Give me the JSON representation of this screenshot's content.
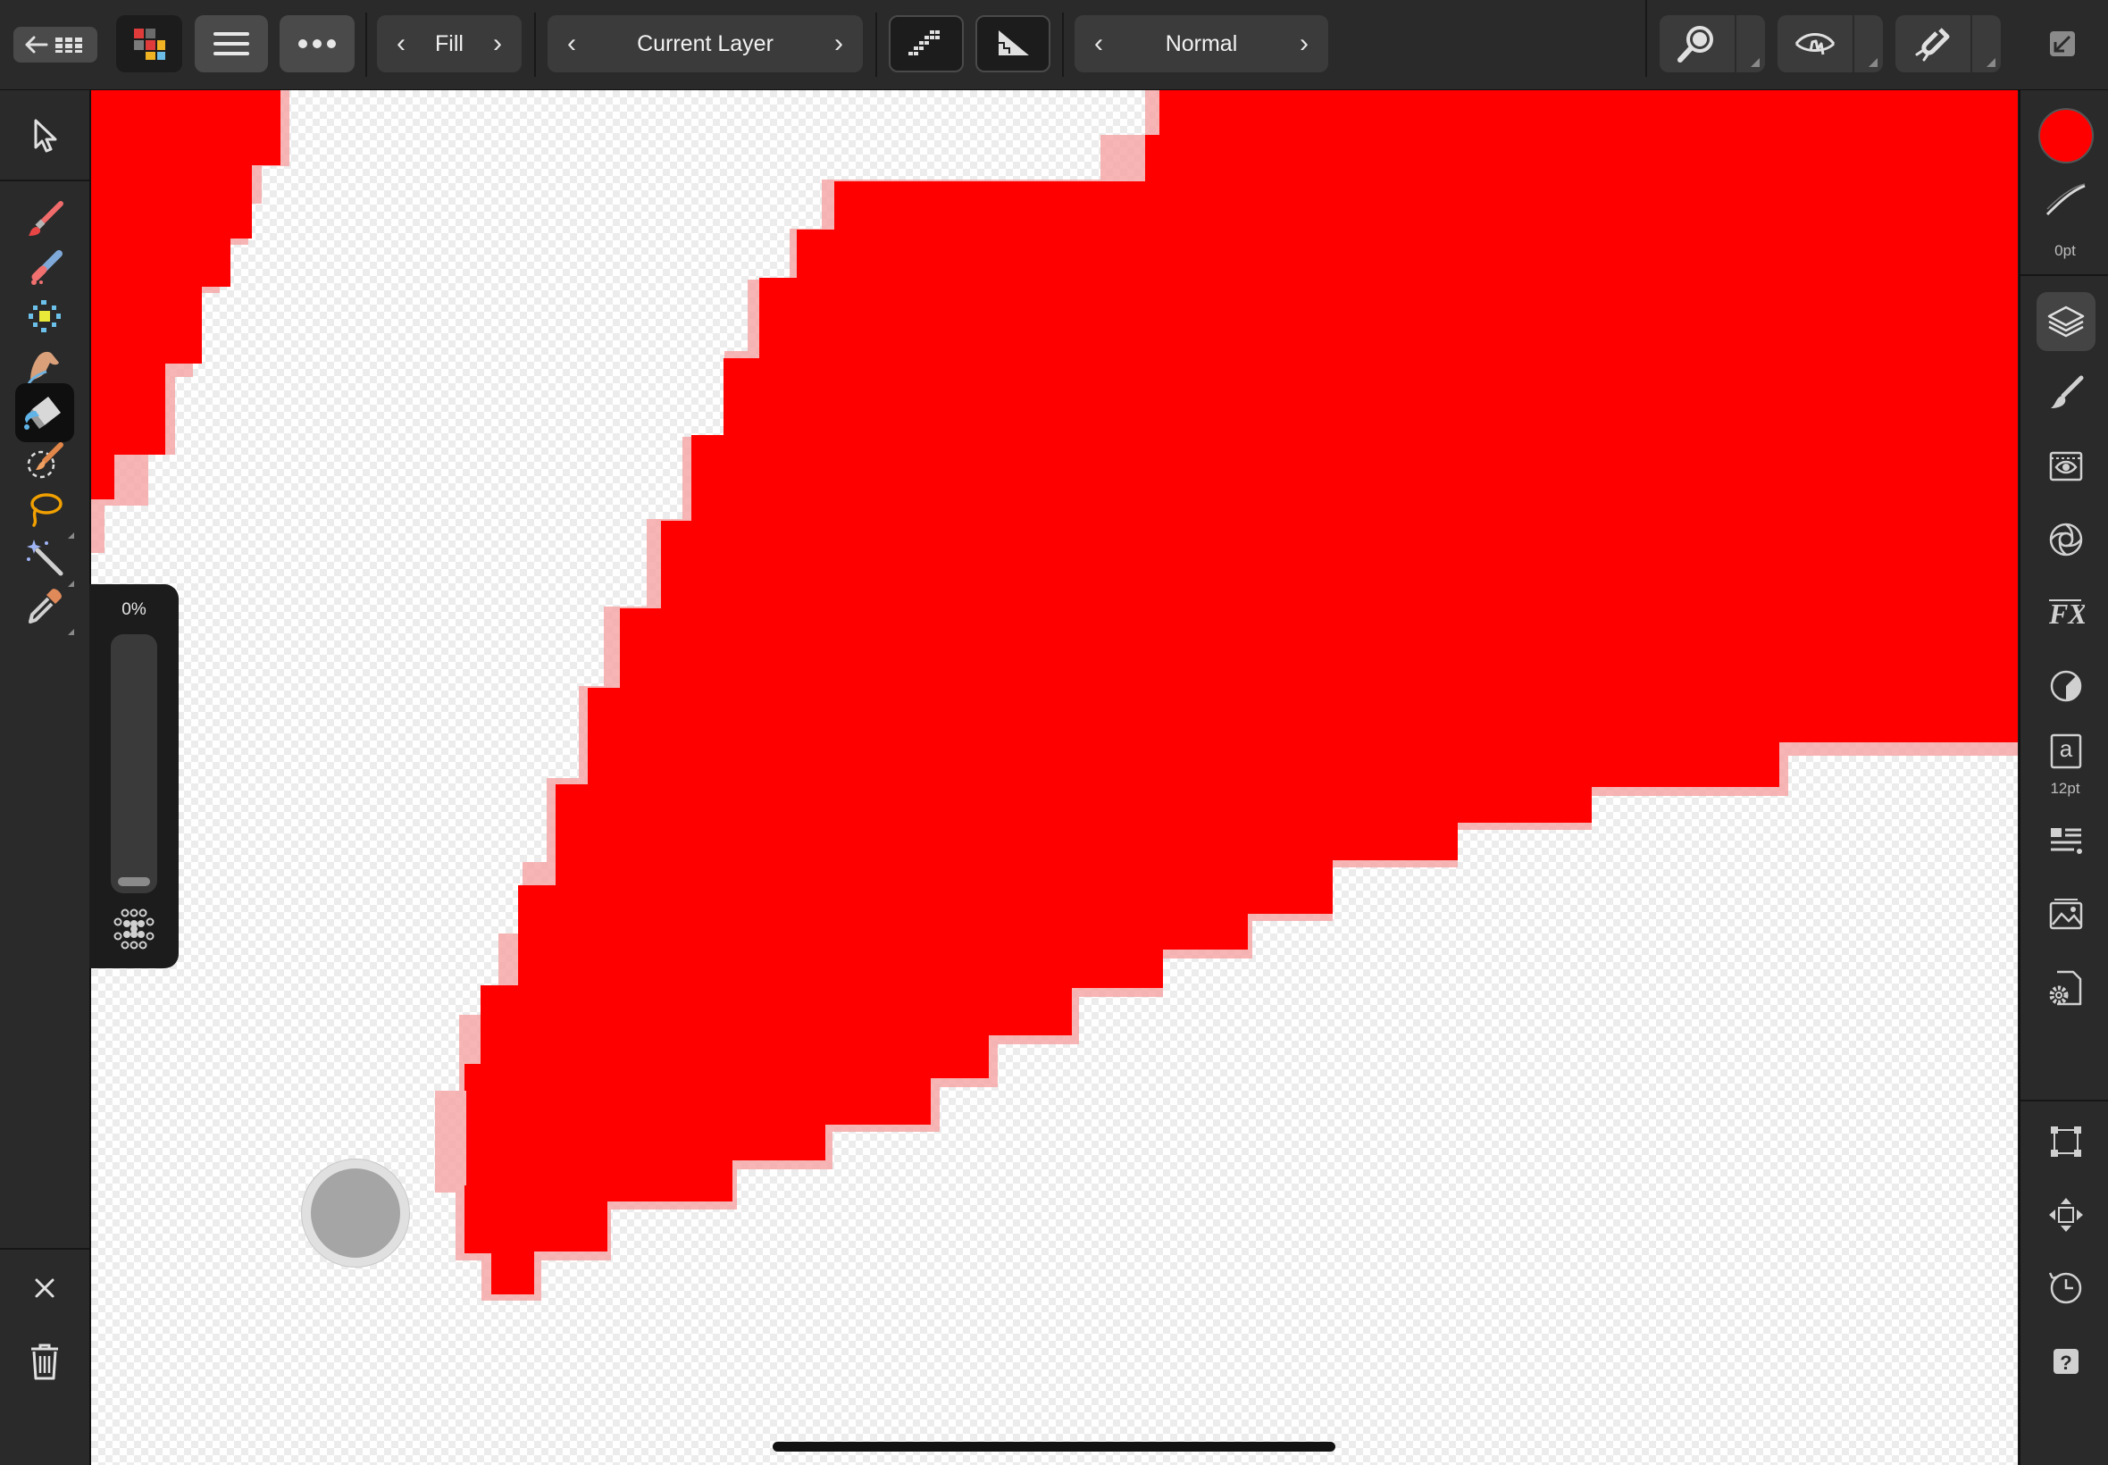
{
  "toolbar": {
    "fill_mode": "Fill",
    "source": "Current Layer",
    "blend_mode": "Normal"
  },
  "opacity": {
    "label": "0%",
    "value": 0
  },
  "stroke": {
    "label": "0pt"
  },
  "text_style": {
    "size_label": "12pt",
    "glyph": "a"
  },
  "colors": {
    "primary": "#ff0000",
    "canvas_fill": "#ff0000",
    "toolbar_bg": "#2a2a2a",
    "button_bg": "#3b3b3b"
  },
  "left_tools": [
    "move-tool",
    "paint-brush-tool",
    "erase-brush-tool",
    "pixel-tool",
    "smudge-tool",
    "flood-fill-tool",
    "selection-brush-tool",
    "freehand-selection-tool",
    "magic-wand-tool",
    "color-picker-tool"
  ],
  "right_studios": [
    "layers",
    "brushes",
    "channels",
    "adjustments",
    "fx",
    "color-adjust",
    "text-styles",
    "character",
    "stock",
    "document-settings",
    "transform",
    "navigator",
    "history",
    "help"
  ]
}
